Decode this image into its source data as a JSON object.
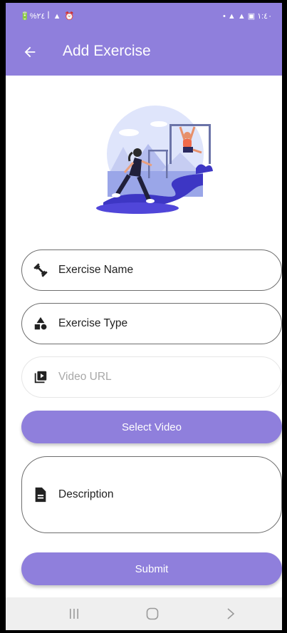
{
  "status_bar": {
    "left_text": "🔋%٢٤ ꟾ ▲ ⏰",
    "right_text": "• ▲ ▲ ▣ ١:٤٠"
  },
  "app_bar": {
    "title": "Add Exercise",
    "back_icon": "arrow-left-icon"
  },
  "illustration": {
    "description_icon": "fitness-illustration"
  },
  "form": {
    "exercise_name": {
      "label": "Exercise Name",
      "icon": "fitness-center-icon"
    },
    "exercise_type": {
      "label": "Exercise Type",
      "icon": "category-icon"
    },
    "video_url": {
      "label": "Video URL",
      "icon": "video-library-icon"
    },
    "select_video_label": "Select Video",
    "description": {
      "label": "Description",
      "icon": "document-icon"
    },
    "submit_label": "Submit"
  },
  "nav_bar": {
    "recents_icon": "recents-icon",
    "home_icon": "home-icon",
    "back_icon": "chevron-right-icon"
  },
  "colors": {
    "accent": "#8f7fdc"
  }
}
